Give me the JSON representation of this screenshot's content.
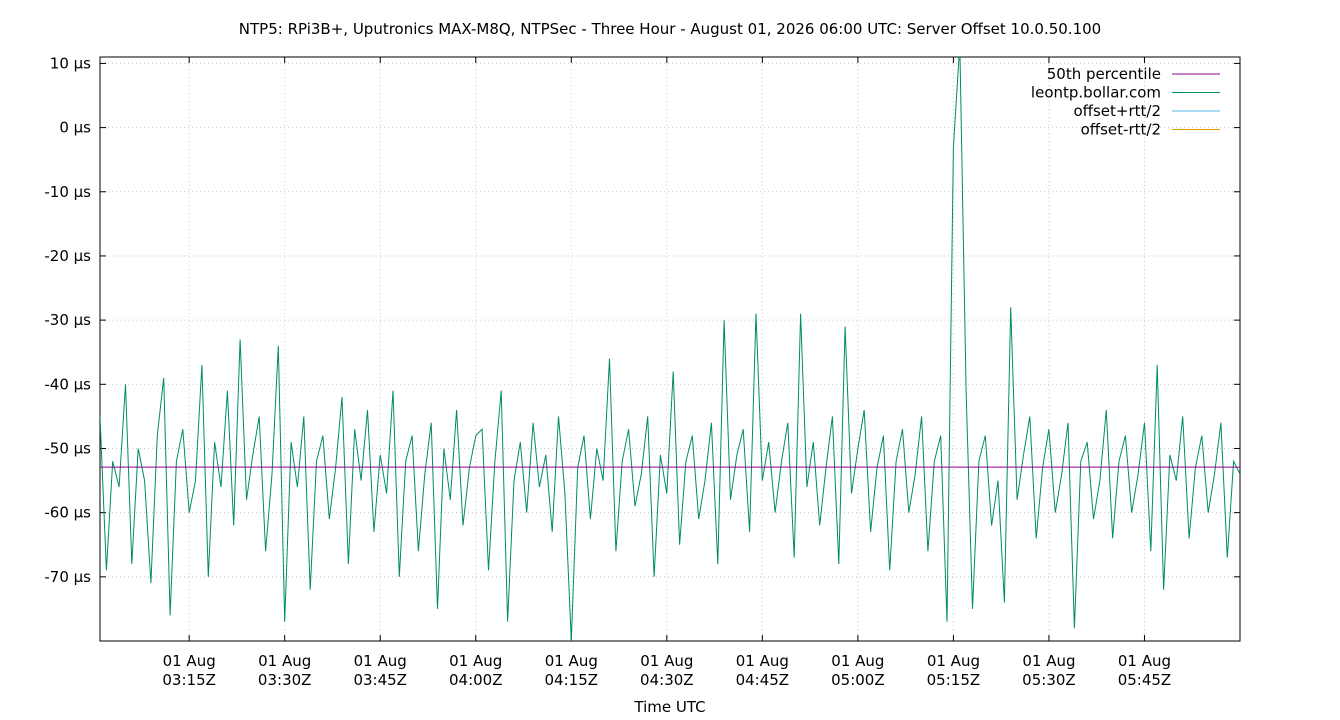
{
  "chart_data": {
    "type": "line",
    "title": "NTP5: RPi3B+, Uputronics MAX-M8Q, NTPSec - Three Hour - August 01, 2026 06:00 UTC: Server Offset 10.0.50.100",
    "xlabel": "Time UTC",
    "ylabel": "",
    "y_unit": "µs",
    "ylim": [
      -80,
      11
    ],
    "xlim": [
      "2026-08-01T03:01:00Z",
      "2026-08-01T06:00:00Z"
    ],
    "grid": true,
    "legend_position": "top-right",
    "y_ticks": [
      {
        "value": 10,
        "label": "10 µs"
      },
      {
        "value": 0,
        "label": "0 µs"
      },
      {
        "value": -10,
        "label": "-10 µs"
      },
      {
        "value": -20,
        "label": "-20 µs"
      },
      {
        "value": -30,
        "label": "-30 µs"
      },
      {
        "value": -40,
        "label": "-40 µs"
      },
      {
        "value": -50,
        "label": "-50 µs"
      },
      {
        "value": -60,
        "label": "-60 µs"
      },
      {
        "value": -70,
        "label": "-70 µs"
      }
    ],
    "x_ticks": [
      {
        "value": "2026-08-01T03:15:00Z",
        "line1": "01 Aug",
        "line2": "03:15Z"
      },
      {
        "value": "2026-08-01T03:30:00Z",
        "line1": "01 Aug",
        "line2": "03:30Z"
      },
      {
        "value": "2026-08-01T03:45:00Z",
        "line1": "01 Aug",
        "line2": "03:45Z"
      },
      {
        "value": "2026-08-01T04:00:00Z",
        "line1": "01 Aug",
        "line2": "04:00Z"
      },
      {
        "value": "2026-08-01T04:15:00Z",
        "line1": "01 Aug",
        "line2": "04:15Z"
      },
      {
        "value": "2026-08-01T04:30:00Z",
        "line1": "01 Aug",
        "line2": "04:30Z"
      },
      {
        "value": "2026-08-01T04:45:00Z",
        "line1": "01 Aug",
        "line2": "04:45Z"
      },
      {
        "value": "2026-08-01T05:00:00Z",
        "line1": "01 Aug",
        "line2": "05:00Z"
      },
      {
        "value": "2026-08-01T05:15:00Z",
        "line1": "01 Aug",
        "line2": "05:15Z"
      },
      {
        "value": "2026-08-01T05:30:00Z",
        "line1": "01 Aug",
        "line2": "05:30Z"
      },
      {
        "value": "2026-08-01T05:45:00Z",
        "line1": "01 Aug",
        "line2": "05:45Z"
      }
    ],
    "series": [
      {
        "name": "50th percentile",
        "color": "#8b008b",
        "x": [
          "2026-08-01T03:01:00Z",
          "2026-08-01T06:00:00Z"
        ],
        "values": [
          -52.9,
          -52.9
        ]
      },
      {
        "name": "leontp.bollar.com",
        "color": "#008b6b",
        "x": [
          "2026-08-01T03:01:00Z",
          "2026-08-01T03:02:00Z",
          "2026-08-01T03:03:00Z",
          "2026-08-01T03:04:00Z",
          "2026-08-01T03:05:00Z",
          "2026-08-01T03:06:00Z",
          "2026-08-01T03:07:00Z",
          "2026-08-01T03:08:00Z",
          "2026-08-01T03:09:00Z",
          "2026-08-01T03:10:00Z",
          "2026-08-01T03:11:00Z",
          "2026-08-01T03:12:00Z",
          "2026-08-01T03:13:00Z",
          "2026-08-01T03:14:00Z",
          "2026-08-01T03:15:00Z",
          "2026-08-01T03:16:00Z",
          "2026-08-01T03:17:00Z",
          "2026-08-01T03:18:00Z",
          "2026-08-01T03:19:00Z",
          "2026-08-01T03:20:00Z",
          "2026-08-01T03:21:00Z",
          "2026-08-01T03:22:00Z",
          "2026-08-01T03:23:00Z",
          "2026-08-01T03:24:00Z",
          "2026-08-01T03:25:00Z",
          "2026-08-01T03:26:00Z",
          "2026-08-01T03:27:00Z",
          "2026-08-01T03:28:00Z",
          "2026-08-01T03:29:00Z",
          "2026-08-01T03:30:00Z",
          "2026-08-01T03:31:00Z",
          "2026-08-01T03:32:00Z",
          "2026-08-01T03:33:00Z",
          "2026-08-01T03:34:00Z",
          "2026-08-01T03:35:00Z",
          "2026-08-01T03:36:00Z",
          "2026-08-01T03:37:00Z",
          "2026-08-01T03:38:00Z",
          "2026-08-01T03:39:00Z",
          "2026-08-01T03:40:00Z",
          "2026-08-01T03:41:00Z",
          "2026-08-01T03:42:00Z",
          "2026-08-01T03:43:00Z",
          "2026-08-01T03:44:00Z",
          "2026-08-01T03:45:00Z",
          "2026-08-01T03:46:00Z",
          "2026-08-01T03:47:00Z",
          "2026-08-01T03:48:00Z",
          "2026-08-01T03:49:00Z",
          "2026-08-01T03:50:00Z",
          "2026-08-01T03:51:00Z",
          "2026-08-01T03:52:00Z",
          "2026-08-01T03:53:00Z",
          "2026-08-01T03:54:00Z",
          "2026-08-01T03:55:00Z",
          "2026-08-01T03:56:00Z",
          "2026-08-01T03:57:00Z",
          "2026-08-01T03:58:00Z",
          "2026-08-01T03:59:00Z",
          "2026-08-01T04:00:00Z",
          "2026-08-01T04:01:00Z",
          "2026-08-01T04:02:00Z",
          "2026-08-01T04:03:00Z",
          "2026-08-01T04:04:00Z",
          "2026-08-01T04:05:00Z",
          "2026-08-01T04:06:00Z",
          "2026-08-01T04:07:00Z",
          "2026-08-01T04:08:00Z",
          "2026-08-01T04:09:00Z",
          "2026-08-01T04:10:00Z",
          "2026-08-01T04:11:00Z",
          "2026-08-01T04:12:00Z",
          "2026-08-01T04:13:00Z",
          "2026-08-01T04:14:00Z",
          "2026-08-01T04:15:00Z",
          "2026-08-01T04:16:00Z",
          "2026-08-01T04:17:00Z",
          "2026-08-01T04:18:00Z",
          "2026-08-01T04:19:00Z",
          "2026-08-01T04:20:00Z",
          "2026-08-01T04:21:00Z",
          "2026-08-01T04:22:00Z",
          "2026-08-01T04:23:00Z",
          "2026-08-01T04:24:00Z",
          "2026-08-01T04:25:00Z",
          "2026-08-01T04:26:00Z",
          "2026-08-01T04:27:00Z",
          "2026-08-01T04:28:00Z",
          "2026-08-01T04:29:00Z",
          "2026-08-01T04:30:00Z",
          "2026-08-01T04:31:00Z",
          "2026-08-01T04:32:00Z",
          "2026-08-01T04:33:00Z",
          "2026-08-01T04:34:00Z",
          "2026-08-01T04:35:00Z",
          "2026-08-01T04:36:00Z",
          "2026-08-01T04:37:00Z",
          "2026-08-01T04:38:00Z",
          "2026-08-01T04:39:00Z",
          "2026-08-01T04:40:00Z",
          "2026-08-01T04:41:00Z",
          "2026-08-01T04:42:00Z",
          "2026-08-01T04:43:00Z",
          "2026-08-01T04:44:00Z",
          "2026-08-01T04:45:00Z",
          "2026-08-01T04:46:00Z",
          "2026-08-01T04:47:00Z",
          "2026-08-01T04:48:00Z",
          "2026-08-01T04:49:00Z",
          "2026-08-01T04:50:00Z",
          "2026-08-01T04:51:00Z",
          "2026-08-01T04:52:00Z",
          "2026-08-01T04:53:00Z",
          "2026-08-01T04:54:00Z",
          "2026-08-01T04:55:00Z",
          "2026-08-01T04:56:00Z",
          "2026-08-01T04:57:00Z",
          "2026-08-01T04:58:00Z",
          "2026-08-01T04:59:00Z",
          "2026-08-01T05:00:00Z",
          "2026-08-01T05:01:00Z",
          "2026-08-01T05:02:00Z",
          "2026-08-01T05:03:00Z",
          "2026-08-01T05:04:00Z",
          "2026-08-01T05:05:00Z",
          "2026-08-01T05:06:00Z",
          "2026-08-01T05:07:00Z",
          "2026-08-01T05:08:00Z",
          "2026-08-01T05:09:00Z",
          "2026-08-01T05:10:00Z",
          "2026-08-01T05:11:00Z",
          "2026-08-01T05:12:00Z",
          "2026-08-01T05:13:00Z",
          "2026-08-01T05:14:00Z",
          "2026-08-01T05:15:00Z",
          "2026-08-01T05:16:00Z",
          "2026-08-01T05:17:00Z",
          "2026-08-01T05:18:00Z",
          "2026-08-01T05:19:00Z",
          "2026-08-01T05:20:00Z",
          "2026-08-01T05:21:00Z",
          "2026-08-01T05:22:00Z",
          "2026-08-01T05:23:00Z",
          "2026-08-01T05:24:00Z",
          "2026-08-01T05:25:00Z",
          "2026-08-01T05:26:00Z",
          "2026-08-01T05:27:00Z",
          "2026-08-01T05:28:00Z",
          "2026-08-01T05:29:00Z",
          "2026-08-01T05:30:00Z",
          "2026-08-01T05:31:00Z",
          "2026-08-01T05:32:00Z",
          "2026-08-01T05:33:00Z",
          "2026-08-01T05:34:00Z",
          "2026-08-01T05:35:00Z",
          "2026-08-01T05:36:00Z",
          "2026-08-01T05:37:00Z",
          "2026-08-01T05:38:00Z",
          "2026-08-01T05:39:00Z",
          "2026-08-01T05:40:00Z",
          "2026-08-01T05:41:00Z",
          "2026-08-01T05:42:00Z",
          "2026-08-01T05:43:00Z",
          "2026-08-01T05:44:00Z",
          "2026-08-01T05:45:00Z",
          "2026-08-01T05:46:00Z",
          "2026-08-01T05:47:00Z",
          "2026-08-01T05:48:00Z",
          "2026-08-01T05:49:00Z",
          "2026-08-01T05:50:00Z",
          "2026-08-01T05:51:00Z",
          "2026-08-01T05:52:00Z",
          "2026-08-01T05:53:00Z",
          "2026-08-01T05:54:00Z",
          "2026-08-01T05:55:00Z",
          "2026-08-01T05:56:00Z",
          "2026-08-01T05:57:00Z",
          "2026-08-01T05:58:00Z",
          "2026-08-01T05:59:00Z",
          "2026-08-01T06:00:00Z"
        ],
        "values": [
          -45,
          -69,
          -52,
          -56,
          -40,
          -68,
          -50,
          -55,
          -71,
          -48,
          -39,
          -76,
          -52,
          -47,
          -60,
          -55,
          -37,
          -70,
          -49,
          -56,
          -41,
          -62,
          -33,
          -58,
          -51,
          -45,
          -66,
          -54,
          -34,
          -77,
          -49,
          -56,
          -45,
          -72,
          -52,
          -48,
          -61,
          -53,
          -42,
          -68,
          -47,
          -55,
          -44,
          -63,
          -51,
          -57,
          -41,
          -70,
          -52,
          -48,
          -66,
          -54,
          -46,
          -75,
          -50,
          -58,
          -44,
          -62,
          -53,
          -48,
          -47,
          -69,
          -52,
          -41,
          -77,
          -55,
          -49,
          -60,
          -46,
          -56,
          -51,
          -63,
          -45,
          -57,
          -80,
          -53,
          -48,
          -61,
          -50,
          -55,
          -36,
          -66,
          -52,
          -47,
          -59,
          -54,
          -45,
          -70,
          -51,
          -57,
          -38,
          -65,
          -52,
          -48,
          -61,
          -55,
          -46,
          -68,
          -30,
          -58,
          -51,
          -47,
          -63,
          -29,
          -55,
          -49,
          -60,
          -52,
          -46,
          -67,
          -29,
          -56,
          -49,
          -62,
          -53,
          -45,
          -68,
          -31,
          -57,
          -50,
          -44,
          -63,
          -53,
          -48,
          -69,
          -52,
          -47,
          -60,
          -54,
          -45,
          -66,
          -52,
          -48,
          -77,
          -3,
          13,
          -41,
          -75,
          -52,
          -48,
          -62,
          -55,
          -74,
          -28,
          -58,
          -51,
          -45,
          -64,
          -53,
          -47,
          -60,
          -54,
          -46,
          -78,
          -52,
          -49,
          -61,
          -55,
          -44,
          -64,
          -52,
          -48,
          -60,
          -54,
          -46,
          -66,
          -37,
          -72,
          -51,
          -55,
          -45,
          -64,
          -53,
          -48,
          -60,
          -54,
          -46,
          -67,
          -52,
          -54
        ]
      },
      {
        "name": "offset+rtt/2",
        "color": "#56b4e9",
        "x": [],
        "values": []
      },
      {
        "name": "offset-rtt/2",
        "color": "#e69f00",
        "x": [],
        "values": []
      }
    ]
  }
}
